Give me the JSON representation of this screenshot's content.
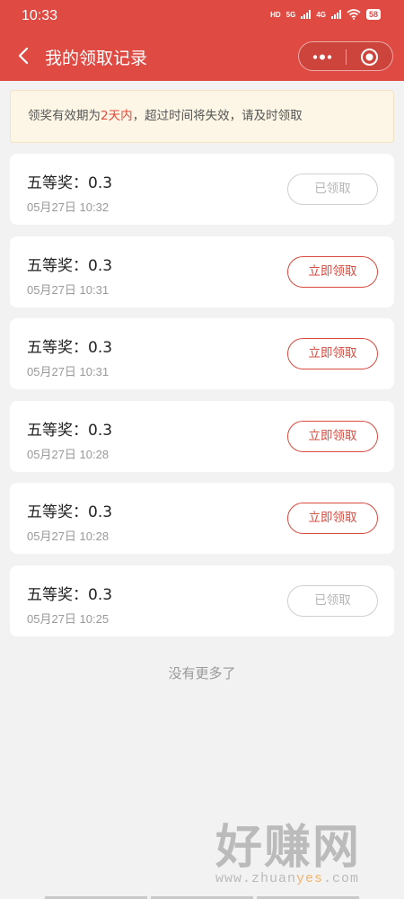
{
  "status_bar": {
    "time": "10:33",
    "hd_label": "HD",
    "net1": "5G",
    "net2": "4G",
    "battery": "58"
  },
  "nav": {
    "title": "我的领取记录",
    "back_icon": "chevron-left-icon",
    "more_icon": "more-dots-icon",
    "close_icon": "target-circle-icon"
  },
  "notice": {
    "prefix": "领奖有效期为",
    "highlight": "2天内",
    "suffix": "，超过时间将失效，请及时领取"
  },
  "records": [
    {
      "prize": "五等奖：0.3",
      "time": "05月27日 10:32",
      "button": "已领取",
      "state": "claimed"
    },
    {
      "prize": "五等奖：0.3",
      "time": "05月27日 10:31",
      "button": "立即领取",
      "state": "claim"
    },
    {
      "prize": "五等奖：0.3",
      "time": "05月27日 10:31",
      "button": "立即领取",
      "state": "claim"
    },
    {
      "prize": "五等奖：0.3",
      "time": "05月27日 10:28",
      "button": "立即领取",
      "state": "claim"
    },
    {
      "prize": "五等奖：0.3",
      "time": "05月27日 10:28",
      "button": "立即领取",
      "state": "claim"
    },
    {
      "prize": "五等奖：0.3",
      "time": "05月27日 10:25",
      "button": "已领取",
      "state": "claimed"
    }
  ],
  "footer_text": "没有更多了",
  "watermark": {
    "main": "好赚网",
    "url_pre": "www.zhuan",
    "url_acc": "yes",
    "url_post": ".com"
  },
  "colors": {
    "brand_red": "#df4a43",
    "highlight_red": "#e34a3b",
    "notice_bg": "#fdf6e6"
  }
}
